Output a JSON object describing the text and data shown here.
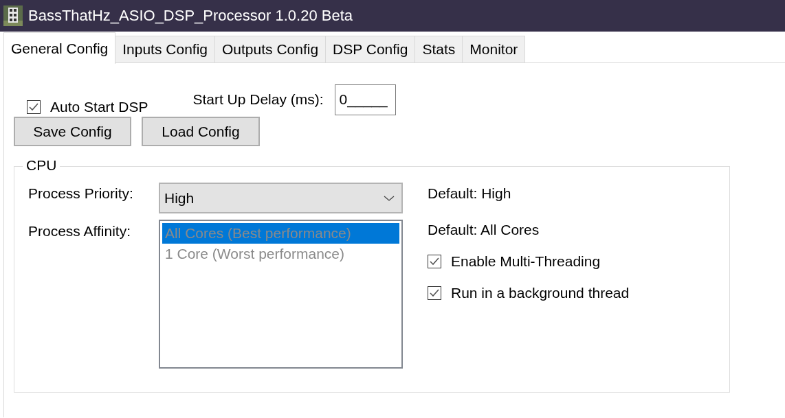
{
  "window": {
    "title": "BassThatHz_ASIO_DSP_Processor 1.0.20 Beta"
  },
  "tabs": [
    {
      "label": "General Config",
      "selected": true
    },
    {
      "label": "Inputs Config",
      "selected": false
    },
    {
      "label": "Outputs Config",
      "selected": false
    },
    {
      "label": "DSP Config",
      "selected": false
    },
    {
      "label": "Stats",
      "selected": false
    },
    {
      "label": "Monitor",
      "selected": false
    }
  ],
  "auto_start": {
    "label": "Auto Start DSP",
    "checked": true
  },
  "startup_delay": {
    "label": "Start Up Delay (ms):",
    "value": "0_____"
  },
  "buttons": [
    "Save Config",
    "Load Config"
  ],
  "cpu": {
    "title": "CPU",
    "priority": {
      "label": "Process Priority:",
      "value": "High",
      "default": "Default: High"
    },
    "affinity": {
      "label": "Process Affinity:",
      "disabled": true,
      "default": "Default: All Cores",
      "items": [
        {
          "label": "All Cores (Best performance)",
          "selected": true
        },
        {
          "label": "1 Core (Worst performance)",
          "selected": false
        }
      ]
    },
    "options": [
      {
        "label": "Enable Multi-Threading",
        "checked": true
      },
      {
        "label": "Run in a background thread",
        "checked": true
      }
    ]
  }
}
